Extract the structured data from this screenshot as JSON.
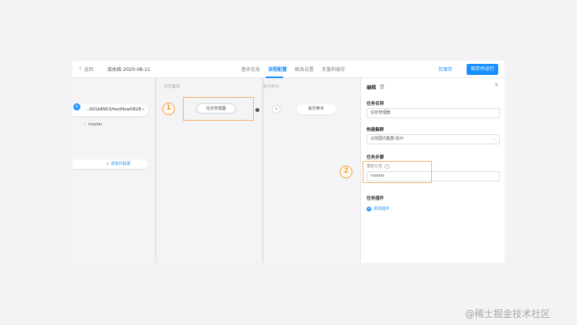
{
  "topbar": {
    "back_label": "返回",
    "pipeline_title": "流水线 2020-08-11",
    "tabs": [
      "基本信息",
      "流程配置",
      "触发设置",
      "变量和缓存"
    ],
    "draft_label": "仅保存",
    "run_label": "保存并运行"
  },
  "canvas": {
    "stage_labels": [
      "任务集成",
      "执行命令"
    ],
    "repo_text": "...001b8903/testflow0828",
    "branch": "master",
    "add_source_label": "添加代码源",
    "task_card_label": "任务管理器",
    "exec_card_label": "执行命令",
    "plus_symbol": "+"
  },
  "badges": {
    "one": "1",
    "two": "2"
  },
  "panel": {
    "title": "编辑",
    "task_name_label": "任务名称",
    "task_name_value": "任务管理器",
    "cluster_label": "构建集群",
    "cluster_value": "云效国内集群-杭州",
    "steps_label": "任务步骤",
    "steps_sub_label": "重新分支",
    "steps_value": "master",
    "plugins_label": "任务插件",
    "add_plugin_label": "添加插件"
  },
  "watermark": "@稀土掘金技术社区",
  "colors": {
    "accent": "#1890ff",
    "highlight": "#f5b366",
    "badge": "#f0a040"
  }
}
